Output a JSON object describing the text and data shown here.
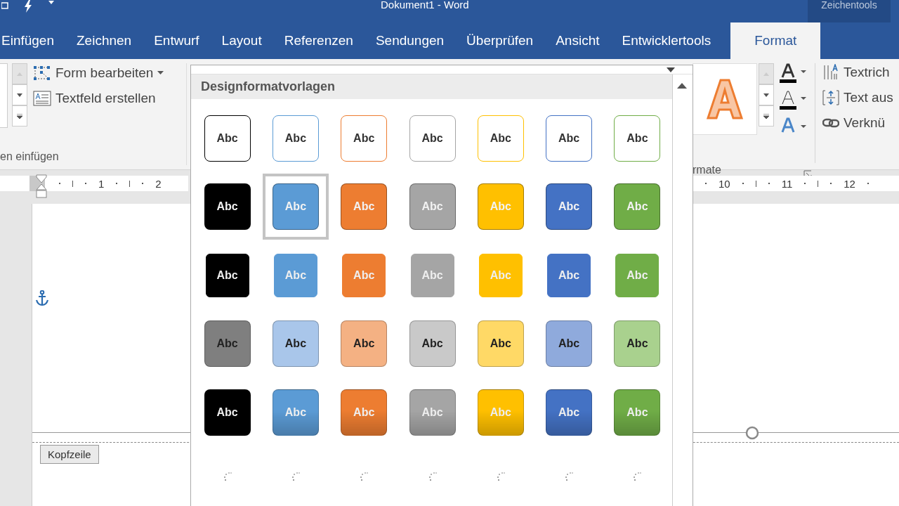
{
  "window": {
    "title": "Dokument1  -  Word",
    "context_label": "Zeichentools"
  },
  "tabs": [
    {
      "label": "Einfügen",
      "selected": false
    },
    {
      "label": "Zeichnen",
      "selected": false
    },
    {
      "label": "Entwurf",
      "selected": false
    },
    {
      "label": "Layout",
      "selected": false
    },
    {
      "label": "Referenzen",
      "selected": false
    },
    {
      "label": "Sendungen",
      "selected": false
    },
    {
      "label": "Überprüfen",
      "selected": false
    },
    {
      "label": "Ansicht",
      "selected": false
    },
    {
      "label": "Entwicklertools",
      "selected": false
    },
    {
      "label": "Format",
      "selected": true
    }
  ],
  "ribbon": {
    "left_commands": [
      {
        "label": "Form bearbeiten",
        "kind": "edit-shape",
        "dropdown": true
      },
      {
        "label": "Textfeld erstellen",
        "kind": "textbox",
        "dropdown": false
      }
    ],
    "left_group_label": "en einfügen",
    "right_group_label": "rmate",
    "right_commands": [
      {
        "label": "Textrich",
        "kind": "direction"
      },
      {
        "label": "Text aus",
        "kind": "align"
      },
      {
        "label": "Verknü",
        "kind": "link"
      }
    ]
  },
  "ruler": {
    "left_numbers": [
      "1",
      "2"
    ],
    "right_numbers": [
      "10",
      "11",
      "12"
    ]
  },
  "document": {
    "header_label": "Kopfzeile"
  },
  "gallery": {
    "title": "Designformatvorlagen",
    "rows": [
      {
        "kind": "outline",
        "items": [
          {
            "label": "Abc",
            "color": "#000000",
            "selected": false
          },
          {
            "label": "Abc",
            "color": "#5b9bd5",
            "selected": false
          },
          {
            "label": "Abc",
            "color": "#ed7d31",
            "selected": false
          },
          {
            "label": "Abc",
            "color": "#a5a5a5",
            "selected": false
          },
          {
            "label": "Abc",
            "color": "#ffc000",
            "selected": false
          },
          {
            "label": "Abc",
            "color": "#4472c4",
            "selected": false
          },
          {
            "label": "Abc",
            "color": "#70ad47",
            "selected": false
          }
        ]
      },
      {
        "kind": "filled",
        "items": [
          {
            "label": "Abc",
            "color": "#000000",
            "selected": false
          },
          {
            "label": "Abc",
            "color": "#5b9bd5",
            "selected": true
          },
          {
            "label": "Abc",
            "color": "#ed7d31",
            "selected": false
          },
          {
            "label": "Abc",
            "color": "#a5a5a5",
            "selected": false
          },
          {
            "label": "Abc",
            "color": "#ffc000",
            "selected": false
          },
          {
            "label": "Abc",
            "color": "#4472c4",
            "selected": false
          },
          {
            "label": "Abc",
            "color": "#70ad47",
            "selected": false
          }
        ]
      },
      {
        "kind": "flat",
        "items": [
          {
            "label": "Abc",
            "color": "#000000",
            "selected": false
          },
          {
            "label": "Abc",
            "color": "#5b9bd5",
            "selected": false
          },
          {
            "label": "Abc",
            "color": "#ed7d31",
            "selected": false
          },
          {
            "label": "Abc",
            "color": "#a5a5a5",
            "selected": false
          },
          {
            "label": "Abc",
            "color": "#ffc000",
            "selected": false
          },
          {
            "label": "Abc",
            "color": "#4472c4",
            "selected": false
          },
          {
            "label": "Abc",
            "color": "#70ad47",
            "selected": false
          }
        ]
      },
      {
        "kind": "light",
        "items": [
          {
            "label": "Abc",
            "color": "#7f7f7f",
            "selected": false
          },
          {
            "label": "Abc",
            "color": "#a9c6ea",
            "selected": false
          },
          {
            "label": "Abc",
            "color": "#f4b183",
            "selected": false
          },
          {
            "label": "Abc",
            "color": "#c9c9c9",
            "selected": false
          },
          {
            "label": "Abc",
            "color": "#ffd966",
            "selected": false
          },
          {
            "label": "Abc",
            "color": "#8faadc",
            "selected": false
          },
          {
            "label": "Abc",
            "color": "#a9d18e",
            "selected": false
          }
        ]
      },
      {
        "kind": "gradient",
        "items": [
          {
            "label": "Abc",
            "color": "#000000",
            "selected": false
          },
          {
            "label": "Abc",
            "color": "#5b9bd5",
            "selected": false
          },
          {
            "label": "Abc",
            "color": "#ed7d31",
            "selected": false
          },
          {
            "label": "Abc",
            "color": "#a5a5a5",
            "selected": false
          },
          {
            "label": "Abc",
            "color": "#ffc000",
            "selected": false
          },
          {
            "label": "Abc",
            "color": "#4472c4",
            "selected": false
          },
          {
            "label": "Abc",
            "color": "#70ad47",
            "selected": false
          }
        ]
      },
      {
        "kind": "loading",
        "items": [
          {
            "loading": true
          },
          {
            "loading": true
          },
          {
            "loading": true
          },
          {
            "loading": true
          },
          {
            "loading": true
          },
          {
            "loading": true
          },
          {
            "loading": true
          }
        ]
      }
    ]
  }
}
